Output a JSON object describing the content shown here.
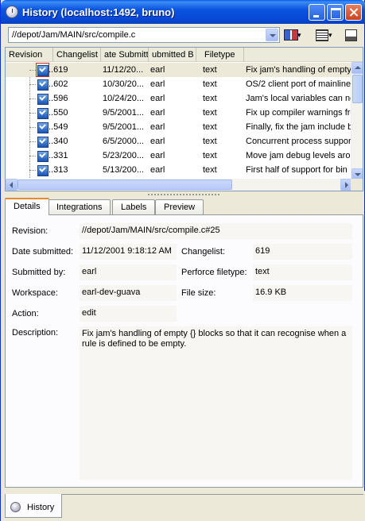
{
  "window": {
    "title": "History (localhost:1492, bruno)"
  },
  "toolbar": {
    "path_value": "//depot/Jam/MAIN/src/compile.c"
  },
  "grid": {
    "columns": [
      "Revision",
      "Changelist",
      "ate Submitte",
      "ubmitted B",
      "Filetype",
      ""
    ],
    "rows": [
      {
        "rev": "..619",
        "date": "11/12/20...",
        "user": "earl",
        "type": "text",
        "desc": "Fix jam's handling of empty",
        "selected": true
      },
      {
        "rev": "..602",
        "date": "10/30/20...",
        "user": "earl",
        "type": "text",
        "desc": "OS/2 client port of mainline"
      },
      {
        "rev": "..596",
        "date": "10/24/20...",
        "user": "earl",
        "type": "text",
        "desc": "Jam's local variables can no"
      },
      {
        "rev": "..550",
        "date": "9/5/2001...",
        "user": "earl",
        "type": "text",
        "desc": "Fix up compiler warnings fro"
      },
      {
        "rev": "..549",
        "date": "9/5/2001...",
        "user": "earl",
        "type": "text",
        "desc": "Finally, fix the jam include b"
      },
      {
        "rev": "..340",
        "date": "6/5/2000...",
        "user": "earl",
        "type": "text",
        "desc": "Concurrent process suppor"
      },
      {
        "rev": "..331",
        "date": "5/23/200...",
        "user": "earl",
        "type": "text",
        "desc": "Move jam debug levels arou"
      },
      {
        "rev": "..313",
        "date": "5/13/200...",
        "user": "earl",
        "type": "text",
        "desc": "First half of support for bin"
      }
    ]
  },
  "tabs": [
    "Details",
    "Integrations",
    "Labels",
    "Preview"
  ],
  "details": {
    "revision_label": "Revision:",
    "revision_value": "//depot/Jam/MAIN/src/compile.c#25",
    "date_label": "Date submitted:",
    "date_value": "11/12/2001 9:18:12 AM",
    "changelist_label": "Changelist:",
    "changelist_value": "619",
    "submitted_label": "Submitted by:",
    "submitted_value": "earl",
    "filetype_label": "Perforce filetype:",
    "filetype_value": "text",
    "workspace_label": "Workspace:",
    "workspace_value": "earl-dev-guava",
    "filesize_label": "File size:",
    "filesize_value": "16.9 KB",
    "action_label": "Action:",
    "action_value": "edit",
    "description_label": "Description:",
    "description_value": "Fix jam's handling of empty {} blocks so that it can recognise when a rule is defined to be empty."
  },
  "bottom_tab": {
    "label": "History"
  },
  "colors": {
    "title_blue": "#0a55e0",
    "tab_accent": "#e68b2c",
    "face": "#ece9d8"
  },
  "icons": [
    "clock-icon",
    "book-icon",
    "columns-icon",
    "layout-icon",
    "checkin-icon"
  ]
}
